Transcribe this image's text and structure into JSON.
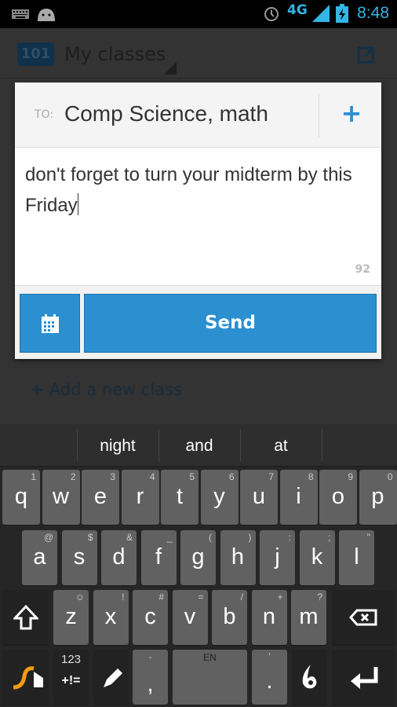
{
  "status": {
    "time": "8:48",
    "network": "4G",
    "icons": [
      "keyboard-icon",
      "android-icon",
      "alarm-icon",
      "signal-icon",
      "battery-charging-icon"
    ]
  },
  "appbar": {
    "logo": "101",
    "title": "My classes",
    "compose_icon": "compose-icon"
  },
  "background": {
    "add_class": "Add a new class"
  },
  "dialog": {
    "to_label": "TO:",
    "to_value": "Comp Science, math",
    "message": "don't forget to turn your midterm by this Friday",
    "char_count": "92",
    "send_label": "Send",
    "accent": "#2b8fd0"
  },
  "suggestions": [
    "night",
    "and",
    "at"
  ],
  "keyboard": {
    "row1": [
      {
        "k": "q",
        "s": "1"
      },
      {
        "k": "w",
        "s": "2"
      },
      {
        "k": "e",
        "s": "3"
      },
      {
        "k": "r",
        "s": "4"
      },
      {
        "k": "t",
        "s": "5"
      },
      {
        "k": "y",
        "s": "6"
      },
      {
        "k": "u",
        "s": "7"
      },
      {
        "k": "i",
        "s": "8"
      },
      {
        "k": "o",
        "s": "9"
      },
      {
        "k": "p",
        "s": "0"
      }
    ],
    "row2": [
      {
        "k": "a",
        "s": "@"
      },
      {
        "k": "s",
        "s": "$"
      },
      {
        "k": "d",
        "s": "&"
      },
      {
        "k": "f",
        "s": "_"
      },
      {
        "k": "g",
        "s": "("
      },
      {
        "k": "h",
        "s": ")"
      },
      {
        "k": "j",
        "s": ":"
      },
      {
        "k": "k",
        "s": ";"
      },
      {
        "k": "l",
        "s": "\""
      }
    ],
    "row3": [
      {
        "k": "z",
        "s": "☺"
      },
      {
        "k": "x",
        "s": "!"
      },
      {
        "k": "c",
        "s": "#"
      },
      {
        "k": "v",
        "s": "="
      },
      {
        "k": "b",
        "s": "/"
      },
      {
        "k": "n",
        "s": "+"
      },
      {
        "k": "m",
        "s": "?"
      }
    ],
    "sym_top": "123",
    "sym_bottom": "+!=",
    "comma": ",",
    "comma_alt": "-",
    "space_label": "EN",
    "period": ".",
    "period_alt": "'"
  }
}
